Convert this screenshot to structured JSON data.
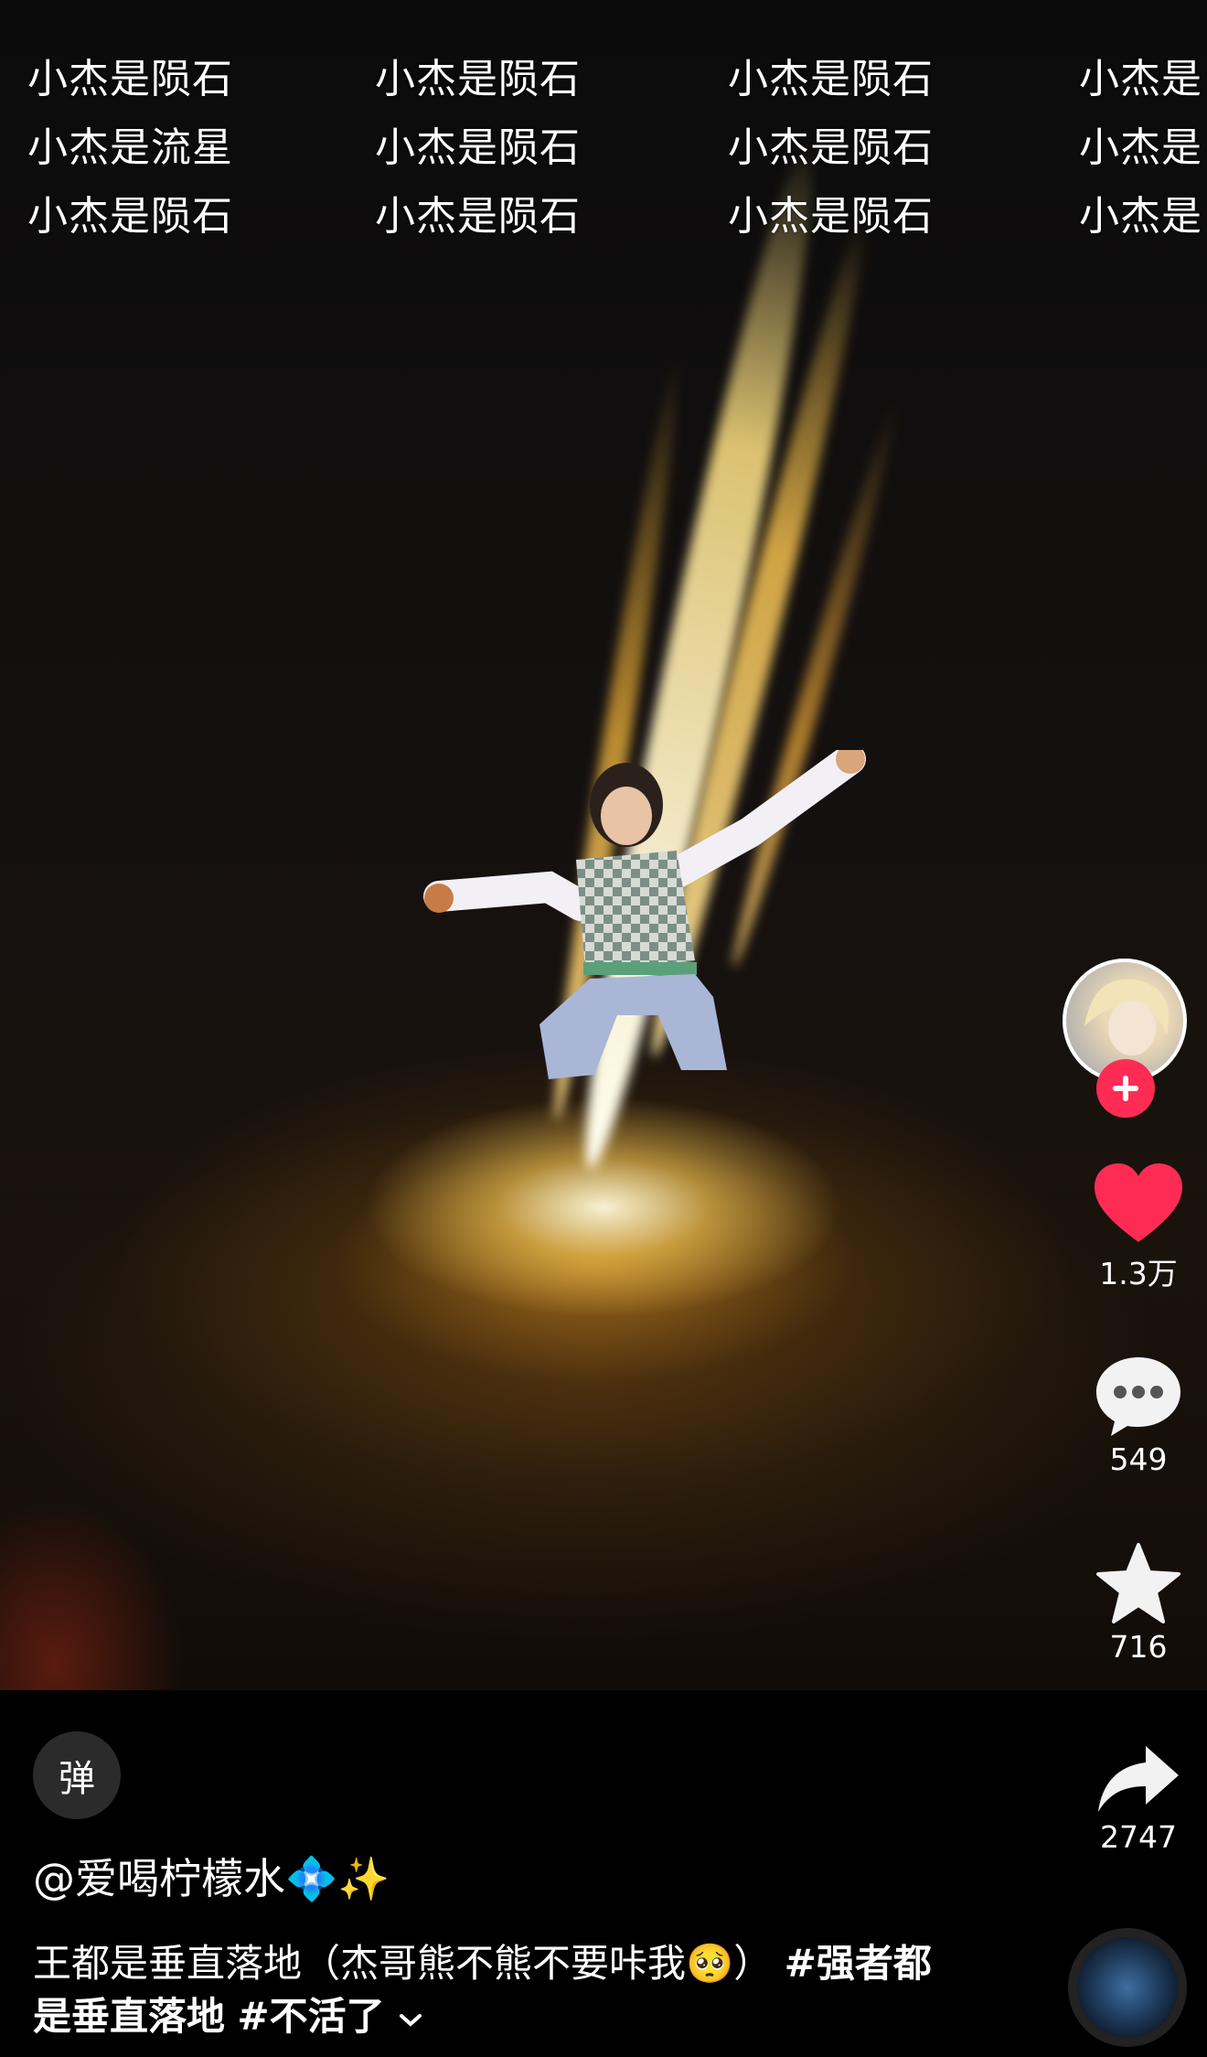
{
  "danmaku": [
    [
      "小杰是陨石",
      "小杰是陨石",
      "小杰是陨石",
      "小杰是"
    ],
    [
      "小杰是流星",
      "小杰是陨石",
      "小杰是陨石",
      "小杰是"
    ],
    [
      "小杰是陨石",
      "小杰是陨石",
      "小杰是陨石",
      "小杰是"
    ]
  ],
  "sidebar": {
    "likes": "1.3万",
    "comments": "549",
    "favorites": "716",
    "shares": "2747"
  },
  "danmu_toggle_label": "弹",
  "author": "@爱喝柠檬水💠✨",
  "caption": {
    "text": "王都是垂直落地（杰哥熊不熊不要咔我🥺）",
    "tag1": "#强者都是垂直落地",
    "tag2": "#不活了"
  },
  "colors": {
    "accent": "#fe2c55",
    "like": "#fe2c55"
  },
  "icons": [
    "plus-icon",
    "heart-icon",
    "comment-icon",
    "star-icon",
    "share-icon",
    "chevron-down-icon"
  ]
}
